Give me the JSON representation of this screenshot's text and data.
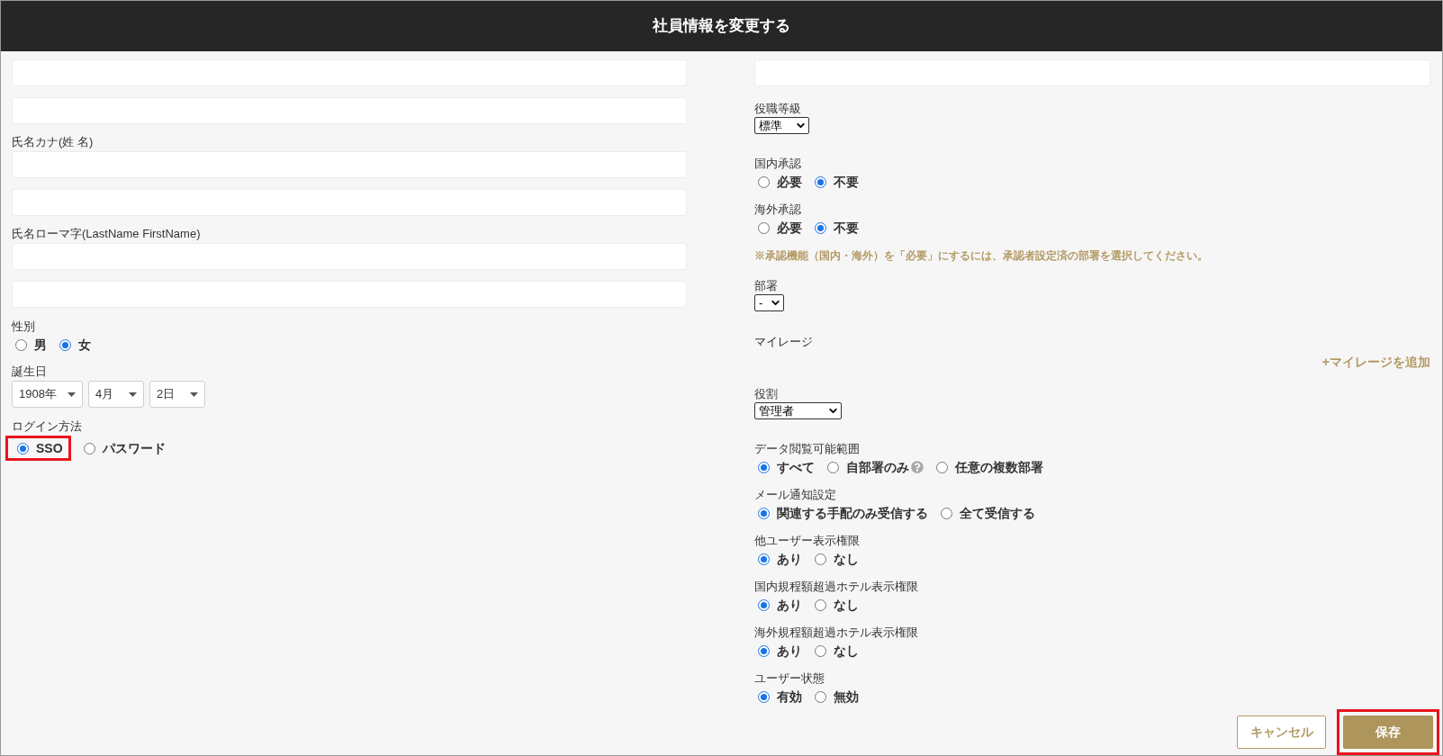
{
  "dialog": {
    "title": "社員情報を変更する"
  },
  "left_column": [
    {
      "kind": "inputs",
      "fields": [
        {
          "kind": "input"
        },
        {
          "kind": "input"
        }
      ]
    },
    {
      "kind": "inputs",
      "label": "氏名カナ(姓 名)",
      "fields": [
        {
          "kind": "input"
        },
        {
          "kind": "input"
        }
      ]
    },
    {
      "kind": "inputs",
      "label": "氏名ローマ字(LastName FirstName)",
      "fields": [
        {
          "kind": "input"
        },
        {
          "kind": "input"
        }
      ]
    },
    {
      "kind": "radios",
      "label": "性別",
      "options": [
        {
          "label": "男",
          "selected": false
        },
        {
          "label": "女",
          "selected": true
        }
      ]
    },
    {
      "kind": "dropdowns",
      "label": "誕生日",
      "dropdowns": [
        {
          "value": "1908年"
        },
        {
          "value": "4月"
        },
        {
          "value": "2日"
        }
      ]
    },
    {
      "kind": "radios",
      "label": "ログイン方法",
      "options": [
        {
          "label": "SSO",
          "selected": true,
          "highlighted": true
        },
        {
          "label": "パスワード",
          "selected": false
        }
      ]
    }
  ],
  "right_column": [
    {
      "kind": "inputs",
      "fields": [
        {
          "kind": "input"
        }
      ]
    },
    {
      "kind": "select",
      "label": "役職等級",
      "value": "標準"
    },
    {
      "kind": "radios",
      "label": "国内承認",
      "options": [
        {
          "label": "必要",
          "selected": false
        },
        {
          "label": "不要",
          "selected": true
        }
      ]
    },
    {
      "kind": "radios",
      "label": "海外承認",
      "options": [
        {
          "label": "必要",
          "selected": false
        },
        {
          "label": "不要",
          "selected": true
        }
      ]
    },
    {
      "kind": "note",
      "text": "※承認機能（国内・海外）を「必要」にするには、承認者設定済の部署を選択してください。"
    },
    {
      "kind": "select",
      "label": "部署",
      "value": "-"
    },
    {
      "kind": "link_row",
      "label": "マイレージ",
      "link": "+マイレージを追加"
    },
    {
      "kind": "select",
      "label": "役割",
      "value": "管理者"
    },
    {
      "kind": "radios",
      "label": "データ閲覧可能範囲",
      "options": [
        {
          "label": "すべて",
          "selected": true
        },
        {
          "label": "自部署のみ",
          "selected": false,
          "help": true
        },
        {
          "label": "任意の複数部署",
          "selected": false
        }
      ]
    },
    {
      "kind": "radios",
      "label": "メール通知設定",
      "options": [
        {
          "label": "関連する手配のみ受信する",
          "selected": true
        },
        {
          "label": "全て受信する",
          "selected": false
        }
      ]
    },
    {
      "kind": "radios",
      "label": "他ユーザー表示権限",
      "options": [
        {
          "label": "あり",
          "selected": true
        },
        {
          "label": "なし",
          "selected": false
        }
      ]
    },
    {
      "kind": "radios",
      "label": "国内規程額超過ホテル表示権限",
      "options": [
        {
          "label": "あり",
          "selected": true
        },
        {
          "label": "なし",
          "selected": false
        }
      ]
    },
    {
      "kind": "radios",
      "label": "海外規程額超過ホテル表示権限",
      "options": [
        {
          "label": "あり",
          "selected": true
        },
        {
          "label": "なし",
          "selected": false
        }
      ]
    },
    {
      "kind": "radios",
      "label": "ユーザー状態",
      "options": [
        {
          "label": "有効",
          "selected": true
        },
        {
          "label": "無効",
          "selected": false
        }
      ]
    }
  ],
  "buttons": [
    {
      "label": "キャンセル",
      "kind": "secondary"
    },
    {
      "label": "保存",
      "kind": "primary",
      "highlighted": true
    }
  ]
}
